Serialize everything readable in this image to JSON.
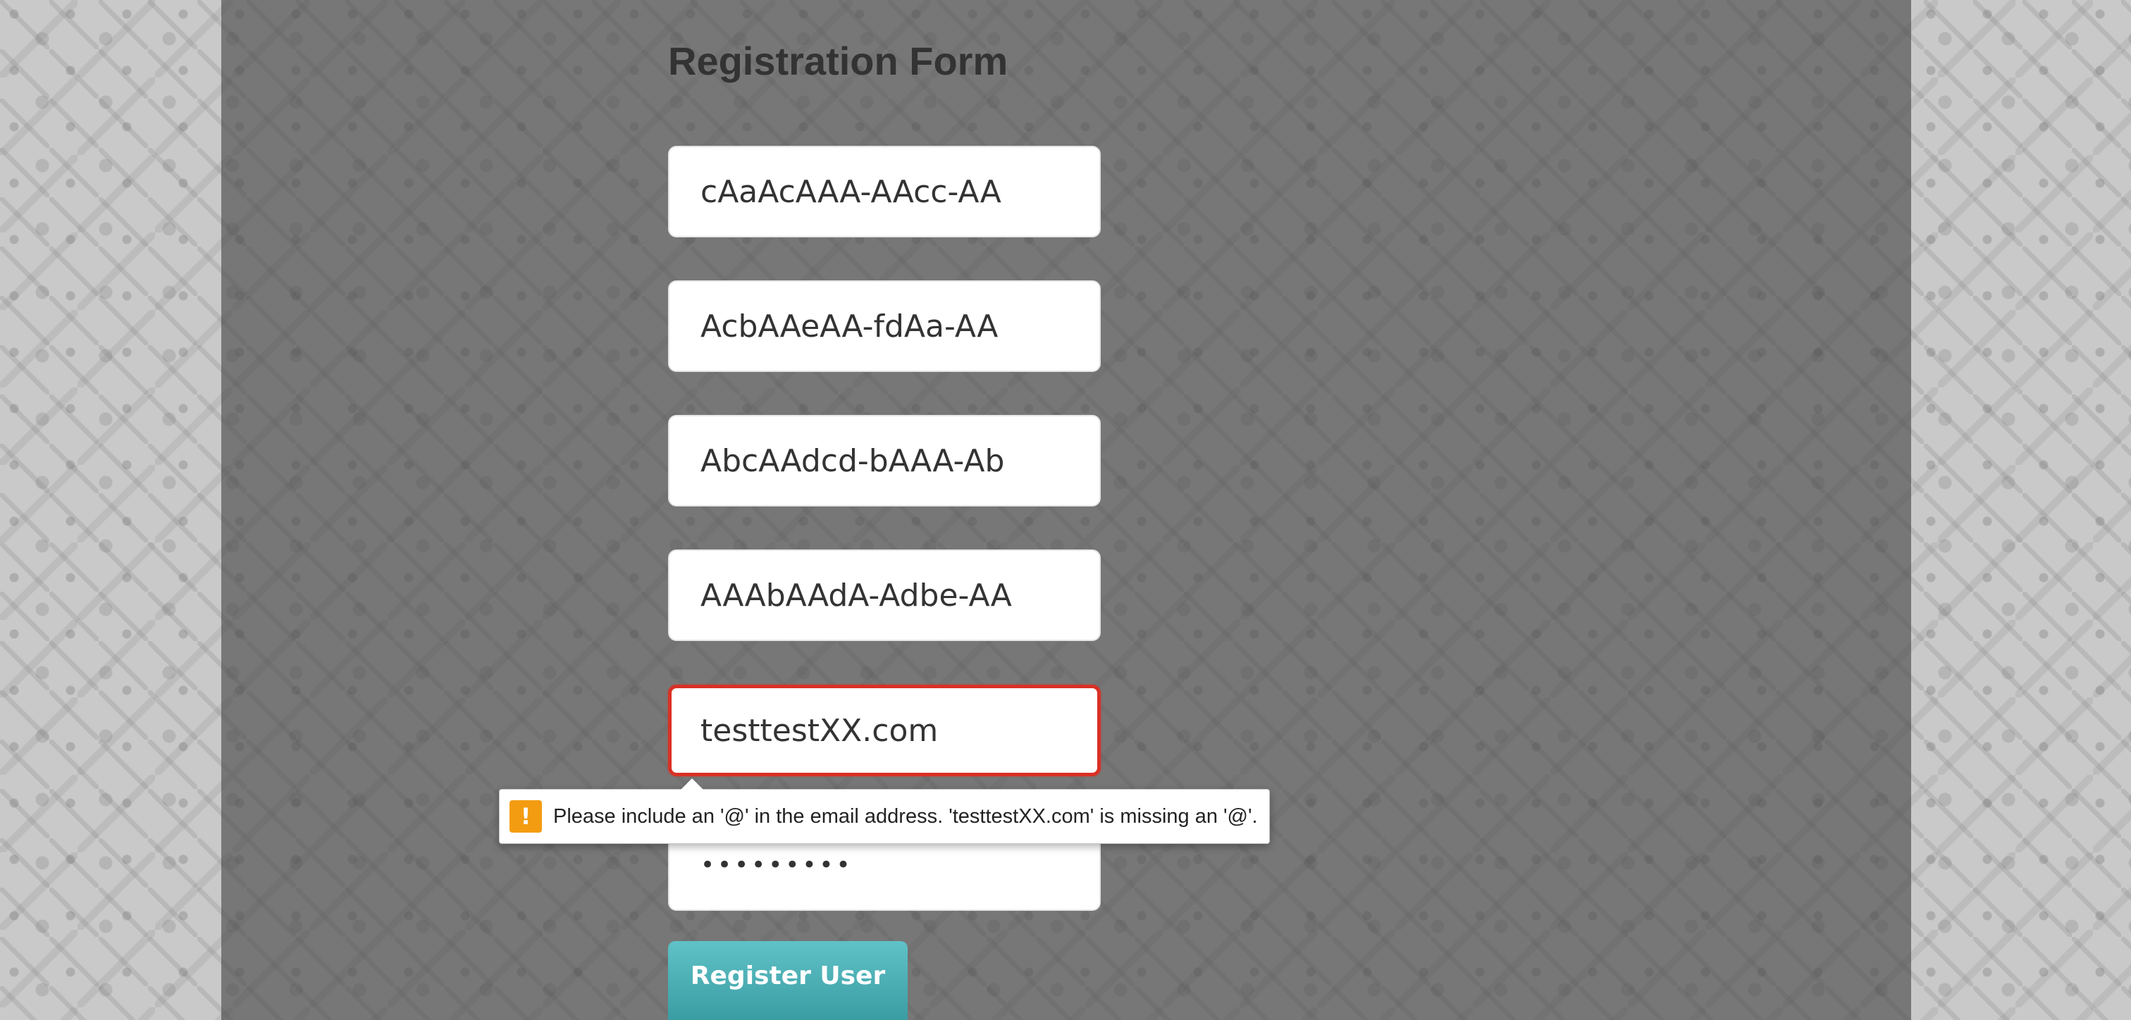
{
  "form": {
    "title": "Registration Form",
    "fields": [
      {
        "value": "cAaAcAAA-AAcc-AA"
      },
      {
        "value": "AcbAAeAA-fdAa-AA"
      },
      {
        "value": "AbcAAdcd-bAAA-Ab"
      },
      {
        "value": "AAAbAAdA-Adbe-AA"
      },
      {
        "value": "testtestXX.com",
        "state": "invalid"
      },
      {
        "value": "•••••••••",
        "type": "password"
      }
    ],
    "submit_label": "Register User"
  },
  "validation": {
    "icon": "warning-icon",
    "icon_glyph": "!",
    "message": "Please include an '@' in the email address. 'testtestXX.com' is missing an '@'."
  },
  "colors": {
    "error_border": "#d93025",
    "warning": "#f39c12",
    "button": "#4aaeb3"
  }
}
